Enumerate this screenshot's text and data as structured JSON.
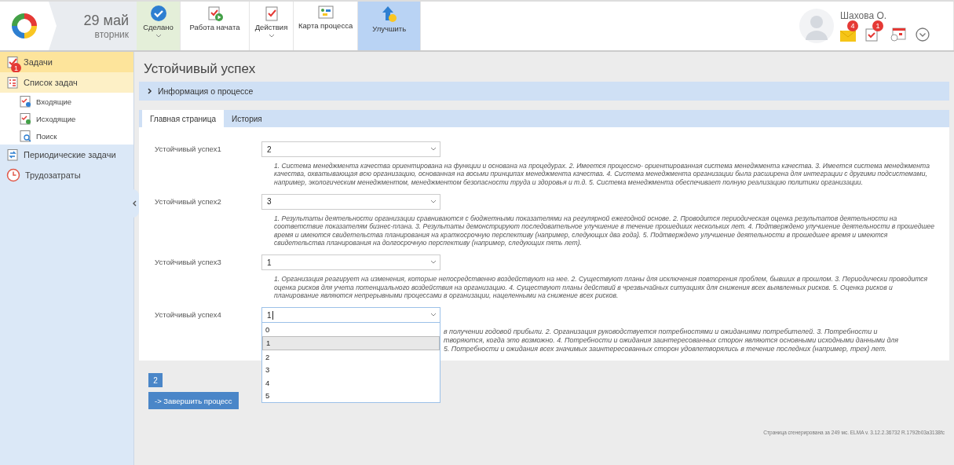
{
  "header": {
    "date": "29 май",
    "weekday": "вторник"
  },
  "toolbar": [
    {
      "kind": "done",
      "label": "Сделано",
      "caret": true,
      "selected": false
    },
    {
      "kind": "started",
      "label": "Работа начата",
      "caret": false,
      "selected": false
    },
    {
      "kind": "actions",
      "label": "Действия",
      "caret": true,
      "selected": false
    },
    {
      "kind": "map",
      "label": "Карта процесса",
      "caret": false,
      "selected": false
    },
    {
      "kind": "improve",
      "label": "Улучшить",
      "caret": false,
      "selected": true
    }
  ],
  "user": {
    "name": "Шахова О.",
    "notifications": [
      {
        "kind": "mail",
        "badge": "4"
      },
      {
        "kind": "task",
        "badge": "1"
      },
      {
        "kind": "calendar"
      },
      {
        "kind": "menu"
      }
    ]
  },
  "sidebar": {
    "items": [
      {
        "kind": "tasks",
        "label": "Задачи",
        "badge": "1",
        "selected": true
      },
      {
        "kind": "list",
        "label": "Список задач",
        "selected": false,
        "expanded": true,
        "children": [
          {
            "kind": "incoming",
            "label": "Входящие"
          },
          {
            "kind": "outgoing",
            "label": "Исходящие"
          },
          {
            "kind": "search",
            "label": "Поиск"
          }
        ]
      },
      {
        "kind": "periodic",
        "label": "Периодические задачи",
        "selected": false
      },
      {
        "kind": "time",
        "label": "Трудозатраты",
        "selected": false
      }
    ]
  },
  "page": {
    "title": "Устойчивый успех",
    "info_panel": {
      "label": "Информация о процессе",
      "expanded": false
    },
    "tabs": [
      {
        "label": "Главная страница",
        "selected": true
      },
      {
        "label": "История",
        "selected": false
      }
    ],
    "fields": [
      {
        "label": "Устойчивый успех1",
        "value": "2",
        "focused": false,
        "description": "1. Система менеджмента качества ориентирована на функции и основана на процедурах. 2. Имеется процессно- ориентированная система менеджмента качества. 3. Имеется система менеджмента качества, охватывающая всю организацию, основанная на восьми принципах менеджмента качества. 4. Система менеджмента организации была расширена для интеграции с другими подсистемами, например, экологическим менеджментом, менеджментом безопасности труда и здоровья и т.д. 5. Система менеджмента обеспечивает полную реализацию политики организации."
      },
      {
        "label": "Устойчивый успех2",
        "value": "3",
        "focused": false,
        "description": "1. Результаты деятельности организации сравниваются с бюджетными показателями на регулярной ежегодной основе. 2. Проводится периодическая оценка результатов деятельности на соответствие показателям бизнес-плана. 3. Результаты демонстрируют последовательное улучшение в течение прошедших нескольких лет. 4. Подтверждено улучшение деятельности в прошедшее время и имеются свидетельства планирования на краткосрочную перспективу (например, следующих два года). 5. Подтверждено улучшение деятельности в прошедшее время и имеются свидетельства планирования на долгосрочную перспективу (например, следующих пять лет)."
      },
      {
        "label": "Устойчивый успех3",
        "value": "1",
        "focused": false,
        "description": "1. Организация реагирует на изменения, которые непосредственно воздействуют на нее. 2. Существуют планы для исключения повторения проблем, бывших в прошлом. 3. Периодически проводится оценка рисков для учета потенциального воздействия на организацию. 4. Существуют планы действий в чрезвычайных ситуациях для снижения всех выявленных рисков. 5. Оценка рисков и планирование являются непрерывными процессами в организации, нацеленными на снижение всех рисков."
      },
      {
        "label": "Устойчивый успех4",
        "value": "1",
        "focused": true,
        "description_fragments": [
          "в получении годовой прибыли. 2. Организация руководствуется потребностями и ожиданиями потребителей. 3. Потребности и",
          "творяются, когда это возможно. 4. Потребности и ожидания заинтересованных сторон являются основными исходными данными для",
          "5. Потребности и ожидания всех значимых заинтересованных сторон удовлетворялись в течение последних (например, трех) лет."
        ],
        "options": [
          {
            "label": "0",
            "selected": false
          },
          {
            "label": "1",
            "selected": true
          },
          {
            "label": "2",
            "selected": false
          },
          {
            "label": "3",
            "selected": false
          },
          {
            "label": "4",
            "selected": false
          },
          {
            "label": "5",
            "selected": false
          }
        ]
      }
    ],
    "pager": "2",
    "finish_button": "-> Завершить процесс",
    "footer": "Страница сгенерирована за 249 мс. ELMA v. 3.12.2.36732 R.1792b03a3138fc"
  }
}
